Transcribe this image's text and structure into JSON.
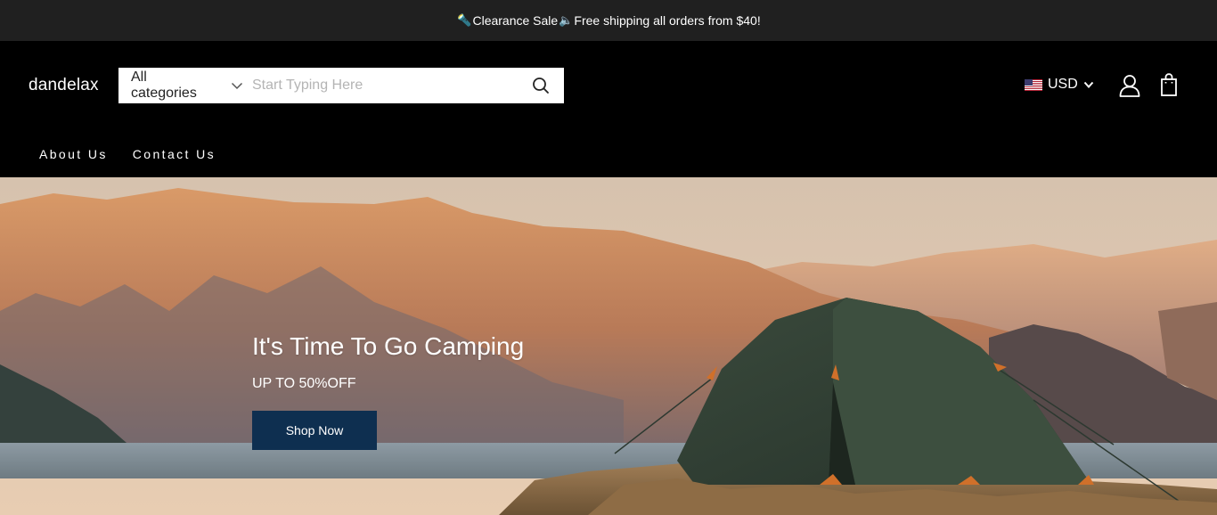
{
  "announcement": {
    "left_emoji": "🔦",
    "sale_text": "Clearance Sale",
    "mid_emoji": "🔈",
    "shipping_text": "Free shipping all orders from $40!"
  },
  "header": {
    "logo": "dandelax",
    "search": {
      "category": "All categories",
      "placeholder": "Start Typing Here",
      "value": ""
    },
    "currency": "USD",
    "icons": {
      "search": "search-icon",
      "chevron": "chevron-down-icon",
      "flag": "us-flag-icon",
      "account": "user-icon",
      "cart": "shopping-bag-icon"
    }
  },
  "nav": {
    "items": [
      {
        "label": "About Us"
      },
      {
        "label": "Contact Us"
      }
    ]
  },
  "hero": {
    "title": "It's Time To Go Camping",
    "subtitle": "UP TO 50%OFF",
    "button": "Shop Now"
  },
  "colors": {
    "announcement_bg": "#202020",
    "header_bg": "#000000",
    "button_bg": "#0e2f50",
    "text": "#ffffff"
  }
}
